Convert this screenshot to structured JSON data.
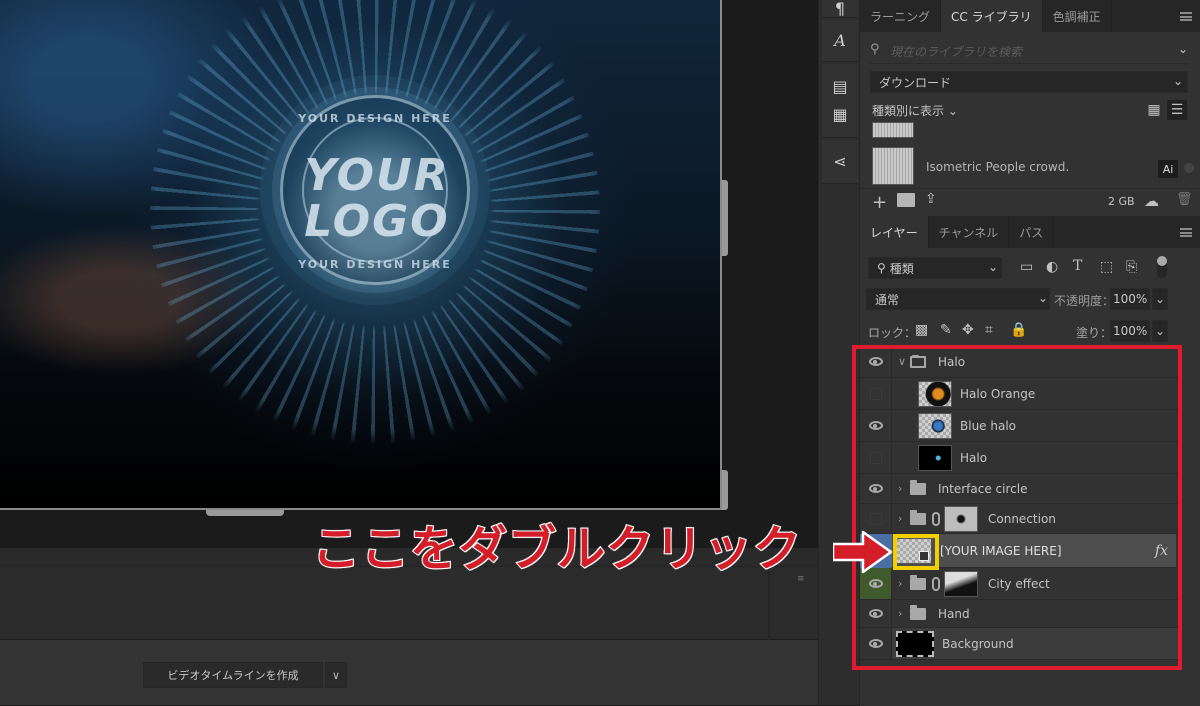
{
  "canvas": {
    "artwork": {
      "ring_text_top": "YOUR DESIGN HERE",
      "logo_line1": "YOUR",
      "logo_line2": "LOGO",
      "ring_text_bottom": "YOUR DESIGN HERE"
    }
  },
  "timeline": {
    "create_button_label": "ビデオタイムラインを作成",
    "dropdown_icon": "chevron-down-icon"
  },
  "dock": {
    "icons": [
      "paragraph-icon",
      "glyphs-icon",
      "properties-icon",
      "notes-icon",
      "share-icon"
    ]
  },
  "library_panel": {
    "tabs": [
      {
        "label": "ラーニング",
        "active": false
      },
      {
        "label": "CC ライブラリ",
        "active": true
      },
      {
        "label": "色調補正",
        "active": false
      }
    ],
    "search_placeholder": "現在のライブラリを検索",
    "library_select": "ダウンロード",
    "view_by_label": "種類別に表示",
    "items": [
      {
        "name": "Isometric People crowd.",
        "badge": "Ai"
      }
    ],
    "storage": "2 GB"
  },
  "layers_panel": {
    "tabs": [
      {
        "label": "レイヤー",
        "active": true
      },
      {
        "label": "チャンネル",
        "active": false
      },
      {
        "label": "パス",
        "active": false
      }
    ],
    "filter_kind": "種類",
    "blend_mode": "通常",
    "opacity_label": "不透明度：",
    "opacity_value": "100%",
    "lock_label": "ロック：",
    "fill_label": "塗り：",
    "fill_value": "100%",
    "layers": [
      {
        "name": "Halo",
        "type": "group",
        "expanded": true,
        "visible": true,
        "indent": 0
      },
      {
        "name": "Halo Orange",
        "type": "layer",
        "visible": false,
        "indent": 1
      },
      {
        "name": "Blue halo",
        "type": "layer",
        "visible": true,
        "indent": 1
      },
      {
        "name": "Halo",
        "type": "layer",
        "visible": false,
        "indent": 1
      },
      {
        "name": "Interface circle",
        "type": "group",
        "expanded": false,
        "visible": true,
        "indent": 0
      },
      {
        "name": "Connection",
        "type": "group-masked",
        "expanded": false,
        "visible": false,
        "indent": 0
      },
      {
        "name": "[YOUR IMAGE HERE]",
        "type": "smart-object",
        "visible": false,
        "selected": true,
        "fx": "fx",
        "indent": 0
      },
      {
        "name": "City effect",
        "type": "group-masked",
        "expanded": false,
        "visible": true,
        "indent": 0
      },
      {
        "name": "Hand",
        "type": "group",
        "expanded": false,
        "visible": true,
        "indent": 0
      },
      {
        "name": "Background",
        "type": "background",
        "visible": true,
        "indent": 0
      }
    ]
  },
  "annotation": {
    "callout_text": "ここをダブルクリック",
    "highlight_color": "#e01b2d",
    "target_color": "#f2d000"
  },
  "colors": {
    "selected_layer": "#4a6fa5",
    "visible_group_tint": "#3f5a2b"
  }
}
